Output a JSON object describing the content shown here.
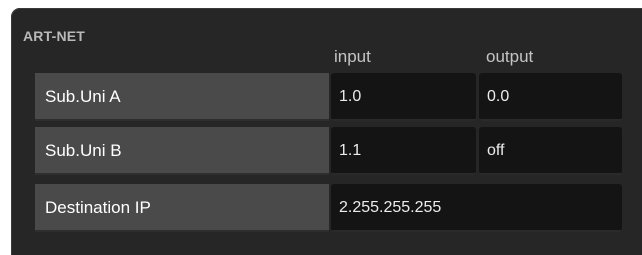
{
  "section": {
    "title": "ART-NET"
  },
  "columns": {
    "input": "input",
    "output": "output"
  },
  "rows": [
    {
      "label": "Sub.Uni A",
      "input": "1.0",
      "output": "0.0"
    },
    {
      "label": "Sub.Uni B",
      "input": "1.1",
      "output": "off"
    },
    {
      "label": "Destination IP",
      "value": "2.255.255.255"
    }
  ]
}
